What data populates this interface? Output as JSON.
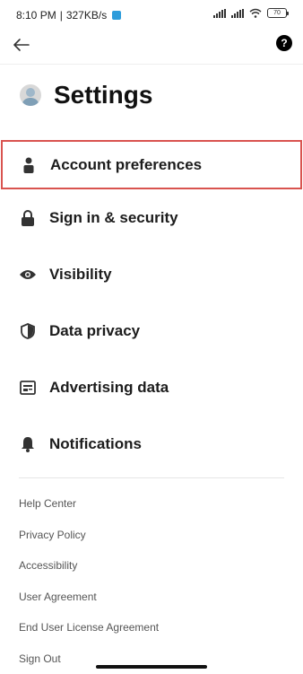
{
  "status_bar": {
    "time": "8:10 PM",
    "network_speed": "327KB/s",
    "battery": "70"
  },
  "top_bar": {
    "help_glyph": "?"
  },
  "header": {
    "title": "Settings"
  },
  "settings": [
    {
      "label": "Account preferences",
      "icon": "person-icon"
    },
    {
      "label": "Sign in & security",
      "icon": "lock-icon"
    },
    {
      "label": "Visibility",
      "icon": "eye-icon"
    },
    {
      "label": "Data privacy",
      "icon": "shield-icon"
    },
    {
      "label": "Advertising data",
      "icon": "ad-card-icon"
    },
    {
      "label": "Notifications",
      "icon": "bell-icon"
    }
  ],
  "footer_links": [
    "Help Center",
    "Privacy Policy",
    "Accessibility",
    "User Agreement",
    "End User License Agreement",
    "Sign Out"
  ],
  "colors": {
    "highlight_border": "#d9534f",
    "text_primary": "#1c1c1c",
    "text_secondary": "#555555"
  }
}
